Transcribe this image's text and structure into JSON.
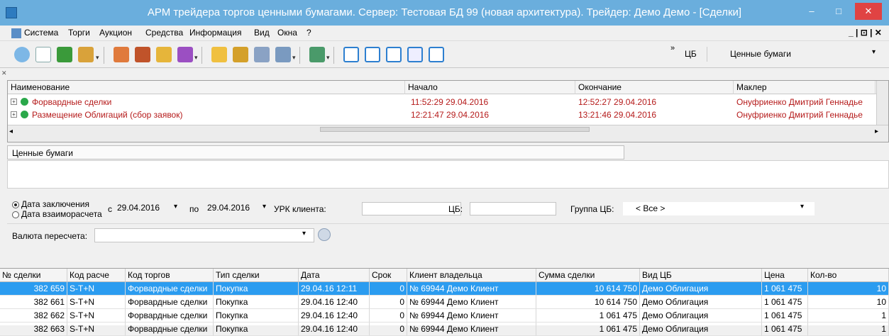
{
  "window": {
    "title": "АРМ трейдера торгов ценными бумагами. Сервер: Тестовая БД 99 (новая архитектура). Трейдер: Демо Демо - [Сделки]",
    "min": "–",
    "max": "□",
    "close": "✕"
  },
  "menu": [
    "Система",
    "Торги",
    "Аукцион",
    "Средства",
    "Информация",
    "Вид",
    "Окна",
    "?"
  ],
  "menu_right": "_ | ⊡ | ✕",
  "toolbar": {
    "cb_label": "ЦБ",
    "cb_value": "Ценные бумаги",
    "overflow": "»"
  },
  "auctions": {
    "columns": [
      "Наименование",
      "Начало",
      "Окончание",
      "Маклер"
    ],
    "rows": [
      {
        "name": "Форвардные сделки",
        "start": "11:52:29 29.04.2016",
        "end": "12:52:27 29.04.2016",
        "broker": "Онуфриенко Дмитрий Геннадье"
      },
      {
        "name": "Размещение Облигаций (сбор заявок)",
        "start": "12:21:47 29.04.2016",
        "end": "13:21:46 29.04.2016",
        "broker": "Онуфриенко Дмитрий Геннадье"
      }
    ]
  },
  "panel_label": "Ценные бумаги",
  "filters": {
    "radio1": "Дата заключения",
    "radio2": "Дата взаиморасчета",
    "from_label": "с",
    "from": "29.04.2016",
    "to_label": "по",
    "to": "29.04.2016",
    "urk_label": "УРК клиента:",
    "cb_label": "ЦБ:",
    "group_label": "Группа ЦБ:",
    "group_value": "< Все >",
    "currency_label": "Валюта пересчета:"
  },
  "deals": {
    "columns": [
      "№ сделки",
      "Код расче",
      "Код торгов",
      "Тип сделки",
      "Дата",
      "Срок",
      "Клиент владельца",
      "Сумма сделки",
      "Вид ЦБ",
      "Цена",
      "Кол-во"
    ],
    "rows": [
      {
        "no": "382 659",
        "calc": "S-T+N",
        "trade": "Форвардные сделки",
        "type": "Покупка",
        "date": "29.04.16 12:11",
        "term": "0",
        "client": "№ 69944 Демо Клиент",
        "sum": "10 614 750",
        "kind": "Демо Облигация",
        "price": "1 061 475",
        "qty": "10"
      },
      {
        "no": "382 661",
        "calc": "S-T+N",
        "trade": "Форвардные сделки",
        "type": "Покупка",
        "date": "29.04.16 12:40",
        "term": "0",
        "client": "№ 69944 Демо Клиент",
        "sum": "10 614 750",
        "kind": "Демо Облигация",
        "price": "1 061 475",
        "qty": "10"
      },
      {
        "no": "382 662",
        "calc": "S-T+N",
        "trade": "Форвардные сделки",
        "type": "Покупка",
        "date": "29.04.16 12:40",
        "term": "0",
        "client": "№ 69944 Демо Клиент",
        "sum": "1 061 475",
        "kind": "Демо Облигация",
        "price": "1 061 475",
        "qty": "1"
      },
      {
        "no": "382 663",
        "calc": "S-T+N",
        "trade": "Форвардные сделки",
        "type": "Покупка",
        "date": "29.04.16 12:40",
        "term": "0",
        "client": "№ 69944 Демо Клиент",
        "sum": "1 061 475",
        "kind": "Демо Облигация",
        "price": "1 061 475",
        "qty": "1"
      }
    ]
  }
}
